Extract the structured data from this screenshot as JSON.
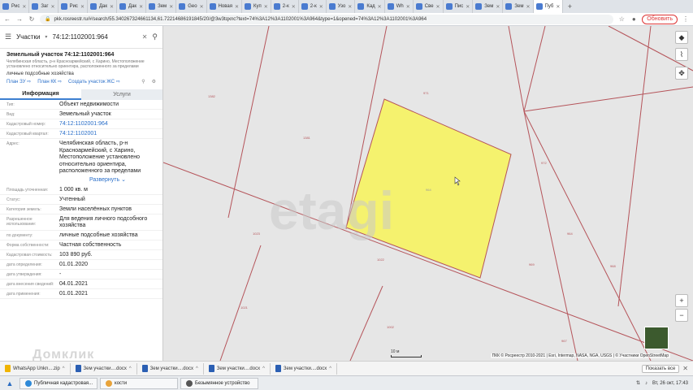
{
  "browser": {
    "tabs": [
      {
        "label": "Рис"
      },
      {
        "label": "Заг"
      },
      {
        "label": "Рис"
      },
      {
        "label": "Дак"
      },
      {
        "label": "Дак"
      },
      {
        "label": "Зем"
      },
      {
        "label": "Geo"
      },
      {
        "label": "Новая"
      },
      {
        "label": "Куп"
      },
      {
        "label": "2-к"
      },
      {
        "label": "2-к"
      },
      {
        "label": "Узо"
      },
      {
        "label": "Кад"
      },
      {
        "label": "Wh"
      },
      {
        "label": "Све"
      },
      {
        "label": "Пис"
      },
      {
        "label": "Зем"
      },
      {
        "label": "Зем"
      },
      {
        "label": "Пуб"
      }
    ],
    "url": "pkk.rosreestr.ru/#/search/55.340267324661134,61.72214686191845/20/@3w3tqxnc?text=74%3A12%3A1102001%3A964&type=1&opened=74%3A12%3A1102001%3A964",
    "update_label": "Обновить"
  },
  "search": {
    "layer": "Участки",
    "query": "74:12:1102001:964"
  },
  "parcel": {
    "title": "Земельный участок 74:12:1102001:964",
    "address_short": "Челябинская область, р-н Красноармейский, с Харино, Местоположение установлено относительно ориентира, расположенного за пределами",
    "purpose": "личные подсобные хозяйства",
    "links": {
      "plan_zu": "План ЗУ ⇨",
      "plan_kk": "План КК ⇨",
      "create_zs": "Создать участок ЖС ⇨"
    },
    "tabs": {
      "info": "Информация",
      "services": "Услуги"
    },
    "rows": [
      {
        "key": "Тип:",
        "value": "Объект недвижимости"
      },
      {
        "key": "Вид:",
        "value": "Земельный участок"
      },
      {
        "key": "Кадастровый номер:",
        "value": "74:12:1102001:964"
      },
      {
        "key": "Кадастровый квартал:",
        "value": "74:12:1102001"
      },
      {
        "key": "Адрес:",
        "value": "Челябинская область, р-н Красноармейский, с Харино, Местоположение установлено относительно ориентира, расположенного за пределами"
      },
      {
        "key": "Площадь уточненная:",
        "value": "1 000 кв. м"
      },
      {
        "key": "Статус:",
        "value": "Учтенный"
      },
      {
        "key": "Категория земель:",
        "value": "Земли населённых пунктов"
      },
      {
        "key": "Разрешенное использование:",
        "value": "Для ведения личного подсобного хозяйства"
      },
      {
        "key": "по документу:",
        "value": "личные подсобные хозяйства"
      },
      {
        "key": "Форма собственности:",
        "value": "Частная собственность"
      },
      {
        "key": "Кадастровая стоимость:",
        "value": "103 890 руб."
      },
      {
        "key": "дата определения:",
        "value": "01.01.2020"
      },
      {
        "key": "дата утверждения:",
        "value": "-"
      },
      {
        "key": "дата внесения сведений:",
        "value": "04.01.2021"
      },
      {
        "key": "дата применения:",
        "value": "01.01.2021"
      }
    ],
    "expand_label": "Развернуть"
  },
  "map": {
    "watermark": "etagi",
    "watermark2": "Домклик",
    "parcel_labels": [
      "1382",
      "971",
      "1381",
      "964",
      "1023",
      "1022",
      "1021",
      "1002",
      "972",
      "964",
      "969",
      "968",
      "967"
    ],
    "scale_label": "10 м",
    "attribution": "ПКК © Росреестр 2010-2021 | Esri, Intermap, NASA, NGA, USGS | © Участники OpenStreetMap",
    "highlight_color": "#f5f26e"
  },
  "downloads": {
    "items": [
      {
        "label": "WhatsApp Unkn....zip"
      },
      {
        "label": "Зем участки....docx"
      },
      {
        "label": "Зем участки....docx"
      },
      {
        "label": "Зем участки....docx"
      },
      {
        "label": "Зем участки....docx"
      }
    ],
    "show_all": "Показать все",
    "close": "✕"
  },
  "taskbar": {
    "items": [
      {
        "label": "Публичная кадастровая..."
      },
      {
        "label": "кости"
      },
      {
        "label": "Безымянное устройство"
      }
    ],
    "clock": "Вт, 26 окт, 17:43"
  }
}
